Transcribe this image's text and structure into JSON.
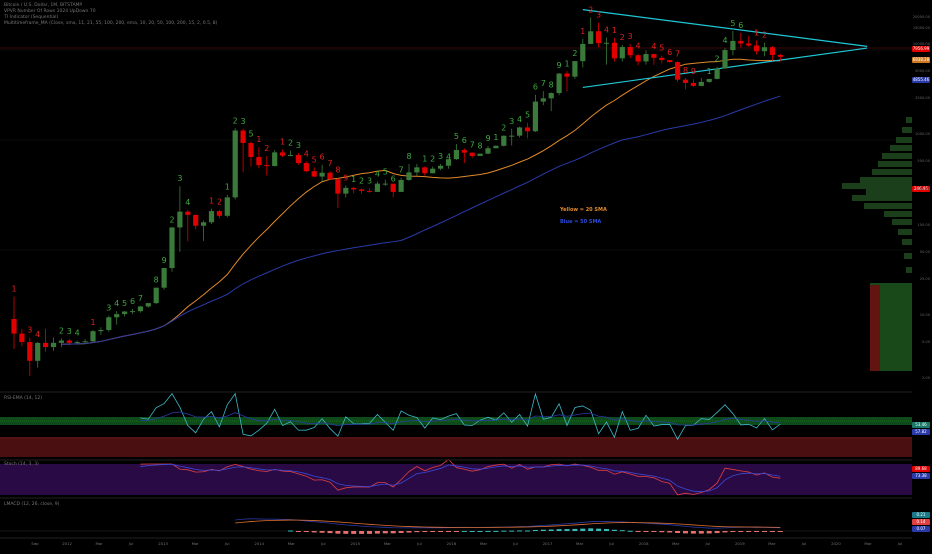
{
  "legend": {
    "main": [
      "Bitcoin / U.S. Dollar, 1M, BITSTAMP",
      "VPVR Number Of Rows 1024 UpDown 70",
      "TI Indicator (Sequential)",
      "Multitimeframe_MA (Close, sma, 11, 21, 55, 100, 200, ema, 10, 20, 50, 100, 200, 15, 2, 0.5, 8)"
    ],
    "rsi": "RSI-EMA (14, 12)",
    "stoch": "Stoch (14, 3, 3)",
    "macd": "LMACD (12, 26, close, 9)"
  },
  "annotations": {
    "yellow": "Yellow = 20 SMA",
    "blue": "Blue = 50 SMA"
  },
  "colors": {
    "background": "#000000",
    "up": "#3a7a3a",
    "down": "#e00000",
    "sma20": "#e08a2c",
    "sma50": "#2a3aa8",
    "trendline": "#1fc7d6",
    "seq_up": "#3fa83f",
    "seq_down": "#e02020",
    "rsi_zone_top": "#0f4a1a",
    "rsi_zone_bottom": "#4a0f10",
    "stoch_bg": "#2a0a45",
    "macd_hist_pos": "#38bcbc",
    "macd_hist_neg": "#e86f6f"
  },
  "price_boxes": [
    {
      "label": "7956.99",
      "color": "#e00000"
    },
    {
      "label": "6938.28",
      "color": "#d07a20"
    },
    {
      "label": "4855.46",
      "color": "#2a3aa8"
    },
    {
      "label": "246.95",
      "color": "#e00000"
    }
  ],
  "right_axis_labels": [
    "20000.00",
    "15000.00",
    "10000.00",
    "5000.00",
    "2500.00",
    "1000.00",
    "500.00",
    "250.00",
    "100.00",
    "50.00",
    "25.00",
    "10.00",
    "5.00",
    "2.00"
  ],
  "rsi_labels": {
    "rsi": "53.46",
    "ema": "57.82"
  },
  "stoch_labels": {
    "k": "89.68",
    "d": "73.38"
  },
  "macd_labels": {
    "a": "0.21",
    "b": "0.14",
    "c": "0.07"
  },
  "chart_data": {
    "type": "candlestick",
    "scale": "log",
    "x_labels": [
      "Sep",
      "2012",
      "Mar",
      "Jul",
      "2013",
      "Mar",
      "Jul",
      "2014",
      "Mar",
      "Jul",
      "2015",
      "Mar",
      "Jul",
      "2016",
      "Mar",
      "Jul",
      "2017",
      "Mar",
      "Jul",
      "2018",
      "Mar",
      "Jul",
      "2019",
      "Mar",
      "Jul",
      "2020",
      "Mar",
      "Jul"
    ],
    "candles": [
      {
        "o": 9,
        "h": 16,
        "l": 4.2,
        "c": 6.2
      },
      {
        "o": 6.2,
        "h": 7,
        "l": 4.5,
        "c": 5
      },
      {
        "o": 5,
        "h": 5.6,
        "l": 2.1,
        "c": 3.1
      },
      {
        "o": 3.1,
        "h": 5,
        "l": 2.6,
        "c": 4.9
      },
      {
        "o": 4.9,
        "h": 7,
        "l": 3.9,
        "c": 4.4
      },
      {
        "o": 4.4,
        "h": 5.6,
        "l": 4,
        "c": 4.9
      },
      {
        "o": 4.9,
        "h": 5.5,
        "l": 4.4,
        "c": 5.2
      },
      {
        "o": 5.2,
        "h": 5.4,
        "l": 4.6,
        "c": 4.9
      },
      {
        "o": 4.9,
        "h": 5.2,
        "l": 4.7,
        "c": 5
      },
      {
        "o": 5,
        "h": 5.4,
        "l": 4.8,
        "c": 5.1
      },
      {
        "o": 5.1,
        "h": 6.8,
        "l": 5,
        "c": 6.6
      },
      {
        "o": 6.6,
        "h": 7.3,
        "l": 6,
        "c": 6.8
      },
      {
        "o": 6.8,
        "h": 9.8,
        "l": 6.5,
        "c": 9.4
      },
      {
        "o": 9.4,
        "h": 11,
        "l": 7.8,
        "c": 10.2
      },
      {
        "o": 10.2,
        "h": 11,
        "l": 9.6,
        "c": 10.9
      },
      {
        "o": 10.9,
        "h": 11.6,
        "l": 10.2,
        "c": 11
      },
      {
        "o": 11,
        "h": 12.5,
        "l": 10.6,
        "c": 12.4
      },
      {
        "o": 12.4,
        "h": 13.5,
        "l": 12,
        "c": 13.5
      },
      {
        "o": 13.5,
        "h": 20,
        "l": 13.2,
        "c": 20
      },
      {
        "o": 20,
        "h": 33,
        "l": 19,
        "c": 33
      },
      {
        "o": 33,
        "h": 93,
        "l": 30,
        "c": 93
      },
      {
        "o": 93,
        "h": 266,
        "l": 50,
        "c": 139
      },
      {
        "o": 139,
        "h": 145,
        "l": 65,
        "c": 128
      },
      {
        "o": 128,
        "h": 129,
        "l": 89,
        "c": 97
      },
      {
        "o": 97,
        "h": 111,
        "l": 66,
        "c": 106
      },
      {
        "o": 106,
        "h": 150,
        "l": 101,
        "c": 141
      },
      {
        "o": 141,
        "h": 146,
        "l": 117,
        "c": 125
      },
      {
        "o": 125,
        "h": 214,
        "l": 120,
        "c": 200
      },
      {
        "o": 200,
        "h": 1165,
        "l": 190,
        "c": 1100
      },
      {
        "o": 1100,
        "h": 1150,
        "l": 380,
        "c": 800
      },
      {
        "o": 800,
        "h": 830,
        "l": 440,
        "c": 560
      },
      {
        "o": 560,
        "h": 720,
        "l": 420,
        "c": 455
      },
      {
        "o": 455,
        "h": 575,
        "l": 350,
        "c": 445
      },
      {
        "o": 445,
        "h": 670,
        "l": 440,
        "c": 630
      },
      {
        "o": 630,
        "h": 680,
        "l": 560,
        "c": 580
      },
      {
        "o": 580,
        "h": 660,
        "l": 570,
        "c": 590
      },
      {
        "o": 590,
        "h": 620,
        "l": 460,
        "c": 480
      },
      {
        "o": 480,
        "h": 500,
        "l": 380,
        "c": 390
      },
      {
        "o": 390,
        "h": 430,
        "l": 335,
        "c": 340
      },
      {
        "o": 340,
        "h": 460,
        "l": 300,
        "c": 375
      },
      {
        "o": 375,
        "h": 390,
        "l": 310,
        "c": 318
      },
      {
        "o": 318,
        "h": 330,
        "l": 152,
        "c": 220
      },
      {
        "o": 220,
        "h": 272,
        "l": 200,
        "c": 255
      },
      {
        "o": 255,
        "h": 262,
        "l": 222,
        "c": 245
      },
      {
        "o": 245,
        "h": 250,
        "l": 220,
        "c": 236
      },
      {
        "o": 236,
        "h": 250,
        "l": 225,
        "c": 230
      },
      {
        "o": 230,
        "h": 300,
        "l": 230,
        "c": 284
      },
      {
        "o": 284,
        "h": 315,
        "l": 268,
        "c": 284
      },
      {
        "o": 284,
        "h": 265,
        "l": 200,
        "c": 230
      },
      {
        "o": 230,
        "h": 330,
        "l": 235,
        "c": 312
      },
      {
        "o": 312,
        "h": 470,
        "l": 305,
        "c": 378
      },
      {
        "o": 378,
        "h": 470,
        "l": 345,
        "c": 430
      },
      {
        "o": 430,
        "h": 440,
        "l": 350,
        "c": 370
      },
      {
        "o": 370,
        "h": 438,
        "l": 368,
        "c": 416
      },
      {
        "o": 416,
        "h": 470,
        "l": 400,
        "c": 448
      },
      {
        "o": 448,
        "h": 460,
        "l": 415,
        "c": 530
      },
      {
        "o": 530,
        "h": 780,
        "l": 520,
        "c": 670
      },
      {
        "o": 670,
        "h": 700,
        "l": 480,
        "c": 625
      },
      {
        "o": 625,
        "h": 630,
        "l": 550,
        "c": 575
      },
      {
        "o": 575,
        "h": 610,
        "l": 570,
        "c": 610
      },
      {
        "o": 610,
        "h": 740,
        "l": 600,
        "c": 700
      },
      {
        "o": 700,
        "h": 756,
        "l": 700,
        "c": 745
      },
      {
        "o": 745,
        "h": 970,
        "l": 730,
        "c": 963
      },
      {
        "o": 963,
        "h": 1150,
        "l": 750,
        "c": 965
      },
      {
        "o": 965,
        "h": 1210,
        "l": 920,
        "c": 1190
      },
      {
        "o": 1190,
        "h": 1350,
        "l": 900,
        "c": 1080
      },
      {
        "o": 1080,
        "h": 2750,
        "l": 1060,
        "c": 2300
      },
      {
        "o": 2300,
        "h": 3000,
        "l": 2100,
        "c": 2500
      },
      {
        "o": 2500,
        "h": 2910,
        "l": 1800,
        "c": 2860
      },
      {
        "o": 2860,
        "h": 4750,
        "l": 2700,
        "c": 4700
      },
      {
        "o": 4700,
        "h": 4980,
        "l": 2980,
        "c": 4340
      },
      {
        "o": 4340,
        "h": 6450,
        "l": 4100,
        "c": 6450
      },
      {
        "o": 6450,
        "h": 11400,
        "l": 5500,
        "c": 10000
      },
      {
        "o": 10000,
        "h": 19700,
        "l": 10000,
        "c": 13800
      },
      {
        "o": 13800,
        "h": 17200,
        "l": 9200,
        "c": 10200
      },
      {
        "o": 10200,
        "h": 11800,
        "l": 5900,
        "c": 10300
      },
      {
        "o": 10300,
        "h": 11700,
        "l": 6400,
        "c": 6930
      },
      {
        "o": 6930,
        "h": 9760,
        "l": 6400,
        "c": 9240
      },
      {
        "o": 9240,
        "h": 9950,
        "l": 7000,
        "c": 7500
      },
      {
        "o": 7500,
        "h": 7790,
        "l": 5800,
        "c": 6400
      },
      {
        "o": 6400,
        "h": 8500,
        "l": 5900,
        "c": 7730
      },
      {
        "o": 7730,
        "h": 7780,
        "l": 5880,
        "c": 7020
      },
      {
        "o": 7020,
        "h": 7400,
        "l": 6100,
        "c": 6630
      },
      {
        "o": 6630,
        "h": 6650,
        "l": 6170,
        "c": 6300
      },
      {
        "o": 6300,
        "h": 6400,
        "l": 3800,
        "c": 4020
      },
      {
        "o": 4020,
        "h": 4200,
        "l": 3150,
        "c": 3700
      },
      {
        "o": 3700,
        "h": 4080,
        "l": 3350,
        "c": 3430
      },
      {
        "o": 3430,
        "h": 4200,
        "l": 3390,
        "c": 3800
      },
      {
        "o": 3800,
        "h": 4100,
        "l": 3700,
        "c": 4100
      },
      {
        "o": 4100,
        "h": 5600,
        "l": 4050,
        "c": 5350
      },
      {
        "o": 5350,
        "h": 9000,
        "l": 5300,
        "c": 8560
      },
      {
        "o": 8560,
        "h": 13900,
        "l": 7500,
        "c": 10800
      },
      {
        "o": 10800,
        "h": 13200,
        "l": 9100,
        "c": 10100
      },
      {
        "o": 10100,
        "h": 12300,
        "l": 9300,
        "c": 9600
      },
      {
        "o": 9600,
        "h": 10950,
        "l": 7700,
        "c": 8300
      },
      {
        "o": 8300,
        "h": 10370,
        "l": 7300,
        "c": 9200
      },
      {
        "o": 9200,
        "h": 9500,
        "l": 6500,
        "c": 7550
      },
      {
        "o": 7550,
        "h": 7750,
        "l": 6450,
        "c": 7200
      }
    ],
    "sequential_counts": [
      {
        "i": 0,
        "t": "1",
        "pos": "above",
        "c": "down"
      },
      {
        "i": 2,
        "t": "3",
        "pos": "above",
        "c": "down"
      },
      {
        "i": 3,
        "t": "4",
        "pos": "above",
        "c": "down"
      },
      {
        "i": 6,
        "t": "2",
        "pos": "above",
        "c": "up"
      },
      {
        "i": 7,
        "t": "3",
        "pos": "above",
        "c": "up"
      },
      {
        "i": 8,
        "t": "4",
        "pos": "above",
        "c": "up"
      },
      {
        "i": 10,
        "t": "1",
        "pos": "above",
        "c": "down"
      },
      {
        "i": 12,
        "t": "3",
        "pos": "above",
        "c": "up"
      },
      {
        "i": 13,
        "t": "4",
        "pos": "above",
        "c": "up"
      },
      {
        "i": 14,
        "t": "5",
        "pos": "above",
        "c": "up"
      },
      {
        "i": 15,
        "t": "6",
        "pos": "above",
        "c": "up"
      },
      {
        "i": 16,
        "t": "7",
        "pos": "above",
        "c": "up"
      },
      {
        "i": 18,
        "t": "8",
        "pos": "above",
        "c": "up"
      },
      {
        "i": 19,
        "t": "9",
        "pos": "above",
        "c": "up"
      },
      {
        "i": 20,
        "t": "2",
        "pos": "above",
        "c": "up"
      },
      {
        "i": 21,
        "t": "3",
        "pos": "above",
        "c": "up"
      },
      {
        "i": 22,
        "t": "4",
        "pos": "above",
        "c": "up"
      },
      {
        "i": 25,
        "t": "1",
        "pos": "above",
        "c": "down"
      },
      {
        "i": 26,
        "t": "2",
        "pos": "above",
        "c": "down"
      },
      {
        "i": 27,
        "t": "1",
        "pos": "above",
        "c": "up"
      },
      {
        "i": 28,
        "t": "2",
        "pos": "above",
        "c": "up"
      },
      {
        "i": 29,
        "t": "3",
        "pos": "above",
        "c": "up"
      },
      {
        "i": 30,
        "t": "5",
        "pos": "above",
        "c": "up"
      },
      {
        "i": 31,
        "t": "1",
        "pos": "above",
        "c": "down"
      },
      {
        "i": 32,
        "t": "2",
        "pos": "above",
        "c": "down"
      },
      {
        "i": 34,
        "t": "1",
        "pos": "above",
        "c": "down"
      },
      {
        "i": 35,
        "t": "2",
        "pos": "above",
        "c": "up"
      },
      {
        "i": 36,
        "t": "3",
        "pos": "above",
        "c": "up"
      },
      {
        "i": 37,
        "t": "4",
        "pos": "above",
        "c": "down"
      },
      {
        "i": 38,
        "t": "5",
        "pos": "above",
        "c": "down"
      },
      {
        "i": 39,
        "t": "6",
        "pos": "above",
        "c": "down"
      },
      {
        "i": 40,
        "t": "7",
        "pos": "above",
        "c": "down"
      },
      {
        "i": 41,
        "t": "8",
        "pos": "above",
        "c": "down"
      },
      {
        "i": 42,
        "t": "9",
        "pos": "above",
        "c": "down"
      },
      {
        "i": 43,
        "t": "1",
        "pos": "above",
        "c": "up"
      },
      {
        "i": 44,
        "t": "2",
        "pos": "above",
        "c": "up"
      },
      {
        "i": 45,
        "t": "3",
        "pos": "above",
        "c": "up"
      },
      {
        "i": 46,
        "t": "4",
        "pos": "above",
        "c": "up"
      },
      {
        "i": 47,
        "t": "5",
        "pos": "above",
        "c": "up"
      },
      {
        "i": 48,
        "t": "6",
        "pos": "above",
        "c": "up"
      },
      {
        "i": 49,
        "t": "7",
        "pos": "above",
        "c": "up"
      },
      {
        "i": 50,
        "t": "8",
        "pos": "above",
        "c": "up"
      },
      {
        "i": 52,
        "t": "1",
        "pos": "above",
        "c": "up"
      },
      {
        "i": 53,
        "t": "2",
        "pos": "above",
        "c": "up"
      },
      {
        "i": 54,
        "t": "3",
        "pos": "above",
        "c": "up"
      },
      {
        "i": 55,
        "t": "4",
        "pos": "above",
        "c": "up"
      },
      {
        "i": 56,
        "t": "5",
        "pos": "above",
        "c": "up"
      },
      {
        "i": 57,
        "t": "6",
        "pos": "above",
        "c": "up"
      },
      {
        "i": 58,
        "t": "7",
        "pos": "above",
        "c": "up"
      },
      {
        "i": 59,
        "t": "8",
        "pos": "above",
        "c": "up"
      },
      {
        "i": 60,
        "t": "9",
        "pos": "above",
        "c": "up"
      },
      {
        "i": 61,
        "t": "1",
        "pos": "above",
        "c": "up"
      },
      {
        "i": 62,
        "t": "2",
        "pos": "above",
        "c": "up"
      },
      {
        "i": 63,
        "t": "3",
        "pos": "above",
        "c": "up"
      },
      {
        "i": 64,
        "t": "4",
        "pos": "above",
        "c": "up"
      },
      {
        "i": 65,
        "t": "5",
        "pos": "above",
        "c": "up"
      },
      {
        "i": 66,
        "t": "6",
        "pos": "above",
        "c": "up"
      },
      {
        "i": 67,
        "t": "7",
        "pos": "above",
        "c": "up"
      },
      {
        "i": 68,
        "t": "8",
        "pos": "above",
        "c": "up"
      },
      {
        "i": 69,
        "t": "9",
        "pos": "above",
        "c": "up"
      },
      {
        "i": 70,
        "t": "1",
        "pos": "above",
        "c": "up"
      },
      {
        "i": 71,
        "t": "2",
        "pos": "above",
        "c": "up"
      },
      {
        "i": 72,
        "t": "1",
        "pos": "above",
        "c": "down"
      },
      {
        "i": 73,
        "t": "2",
        "pos": "above",
        "c": "down"
      },
      {
        "i": 74,
        "t": "3",
        "pos": "above",
        "c": "down"
      },
      {
        "i": 75,
        "t": "4",
        "pos": "above",
        "c": "down"
      },
      {
        "i": 76,
        "t": "1",
        "pos": "above",
        "c": "down"
      },
      {
        "i": 77,
        "t": "2",
        "pos": "above",
        "c": "down"
      },
      {
        "i": 78,
        "t": "3",
        "pos": "above",
        "c": "down"
      },
      {
        "i": 79,
        "t": "4",
        "pos": "above",
        "c": "down"
      },
      {
        "i": 81,
        "t": "4",
        "pos": "above",
        "c": "down"
      },
      {
        "i": 82,
        "t": "5",
        "pos": "above",
        "c": "down"
      },
      {
        "i": 83,
        "t": "6",
        "pos": "above",
        "c": "down"
      },
      {
        "i": 84,
        "t": "7",
        "pos": "above",
        "c": "down"
      },
      {
        "i": 85,
        "t": "8",
        "pos": "above",
        "c": "down"
      },
      {
        "i": 86,
        "t": "9",
        "pos": "above",
        "c": "down"
      },
      {
        "i": 88,
        "t": "1",
        "pos": "above",
        "c": "up"
      },
      {
        "i": 89,
        "t": "2",
        "pos": "above",
        "c": "up"
      },
      {
        "i": 90,
        "t": "4",
        "pos": "above",
        "c": "up"
      },
      {
        "i": 91,
        "t": "5",
        "pos": "above",
        "c": "up"
      },
      {
        "i": 92,
        "t": "6",
        "pos": "above",
        "c": "up"
      },
      {
        "i": 94,
        "t": "1",
        "pos": "above",
        "c": "down"
      },
      {
        "i": 95,
        "t": "2",
        "pos": "above",
        "c": "down"
      }
    ],
    "trendlines": [
      {
        "from": {
          "i": 72,
          "price": 24000
        },
        "to": {
          "i": 108,
          "price": 9400
        }
      },
      {
        "from": {
          "i": 72,
          "price": 3300
        },
        "to": {
          "i": 108,
          "price": 9000
        }
      }
    ],
    "series": [
      {
        "name": "Yellow = 20 SMA",
        "style": "sma",
        "period": 20,
        "color_key": "sma20"
      },
      {
        "name": "Blue = 50 SMA",
        "style": "sma",
        "period": 50,
        "color_key": "sma50"
      }
    ]
  }
}
